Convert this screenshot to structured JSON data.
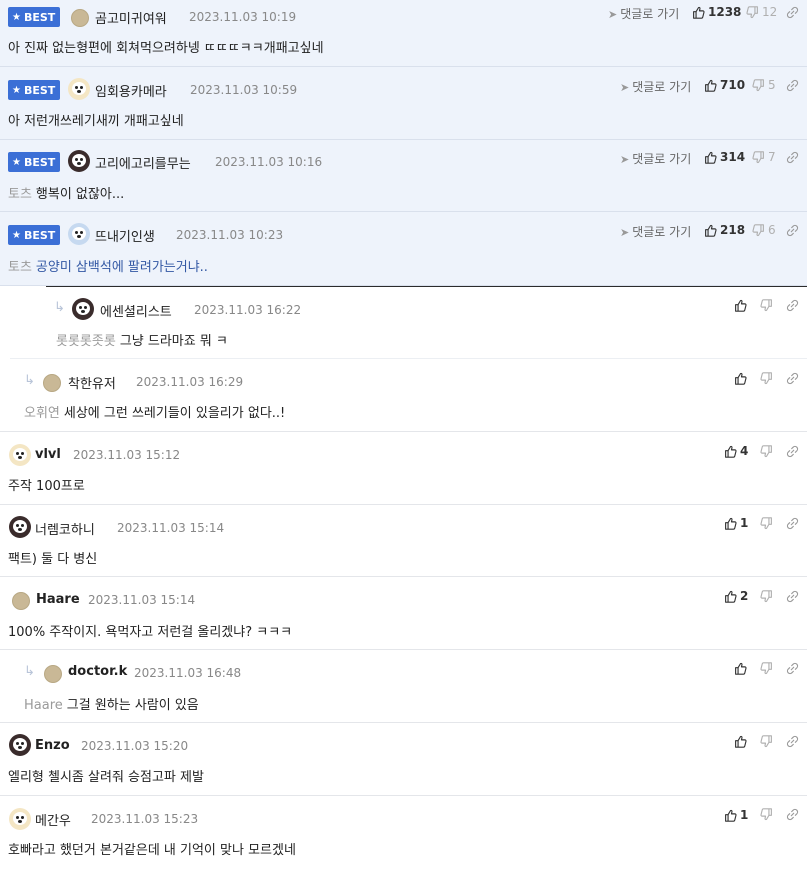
{
  "labels": {
    "best": "BEST",
    "goto": "댓글로 가기"
  },
  "comments": [
    {
      "best": true,
      "nick": "곰고미귀여워",
      "date": "2023.11.03 10:19",
      "text": "아 진짜 없는형편에 회쳐먹으려하넹 ㄸㄸㄸㅋㅋ개패고싶네",
      "mention": "",
      "up": "1238",
      "down": "12"
    },
    {
      "best": true,
      "nick": "임회용카메라",
      "date": "2023.11.03 10:59",
      "text": "아 저런개쓰레기새끼 개패고싶네",
      "mention": "",
      "up": "710",
      "down": "5"
    },
    {
      "best": true,
      "nick": "고리에고리를무는",
      "date": "2023.11.03 10:16",
      "text": "행복이 없잖아...",
      "mention": "토츠",
      "up": "314",
      "down": "7"
    },
    {
      "best": true,
      "nick": "뜨내기인생",
      "date": "2023.11.03 10:23",
      "text": "공양미 삼백석에 팔려가는거냐..",
      "mention": "토츠",
      "up": "218",
      "down": "6"
    },
    {
      "nick": "에센셜리스트",
      "date": "2023.11.03 16:22",
      "text": "그냥 드라마죠 뭐 ㅋ",
      "mention": "롯롯롯좃롯"
    },
    {
      "nick": "착한유저",
      "date": "2023.11.03 16:29",
      "text": "세상에 그런 쓰레기들이 있을리가 없다..!",
      "mention": "오휘연"
    },
    {
      "nick": "vlvl",
      "date": "2023.11.03 15:12",
      "text": "주작 100프로",
      "mention": "",
      "up": "4"
    },
    {
      "nick": "너렘코하니",
      "date": "2023.11.03 15:14",
      "text": "팩트) 둘 다 병신",
      "mention": "",
      "up": "1"
    },
    {
      "nick": "Haare",
      "date": "2023.11.03 15:14",
      "text": "100% 주작이지. 욕먹자고 저런걸 올리겠냐? ㅋㅋㅋ",
      "mention": "",
      "up": "2"
    },
    {
      "nick": "doctor.k",
      "date": "2023.11.03 16:48",
      "text": "그걸 원하는 사람이 있음",
      "mention": "Haare"
    },
    {
      "nick": "Enzo",
      "date": "2023.11.03 15:20",
      "text": "엘리형 첼시좀 살려줘 승점고파 제발",
      "mention": ""
    },
    {
      "nick": "메간우",
      "date": "2023.11.03 15:23",
      "text": "호빠라고 했던거 본거같은데 내 기억이 맞나 모르겠네",
      "mention": "",
      "up": "1"
    }
  ],
  "icons": {
    "best": "star-icon",
    "goto": "send-arrow-icon",
    "up": "thumbs-up-icon",
    "down": "thumbs-down-icon",
    "link": "link-icon",
    "reply": "reply-arrow-icon"
  },
  "colors": {
    "best_badge": "#3b6fd6",
    "best_bg": "#eef3fb",
    "mention": "#9a9a9a"
  }
}
